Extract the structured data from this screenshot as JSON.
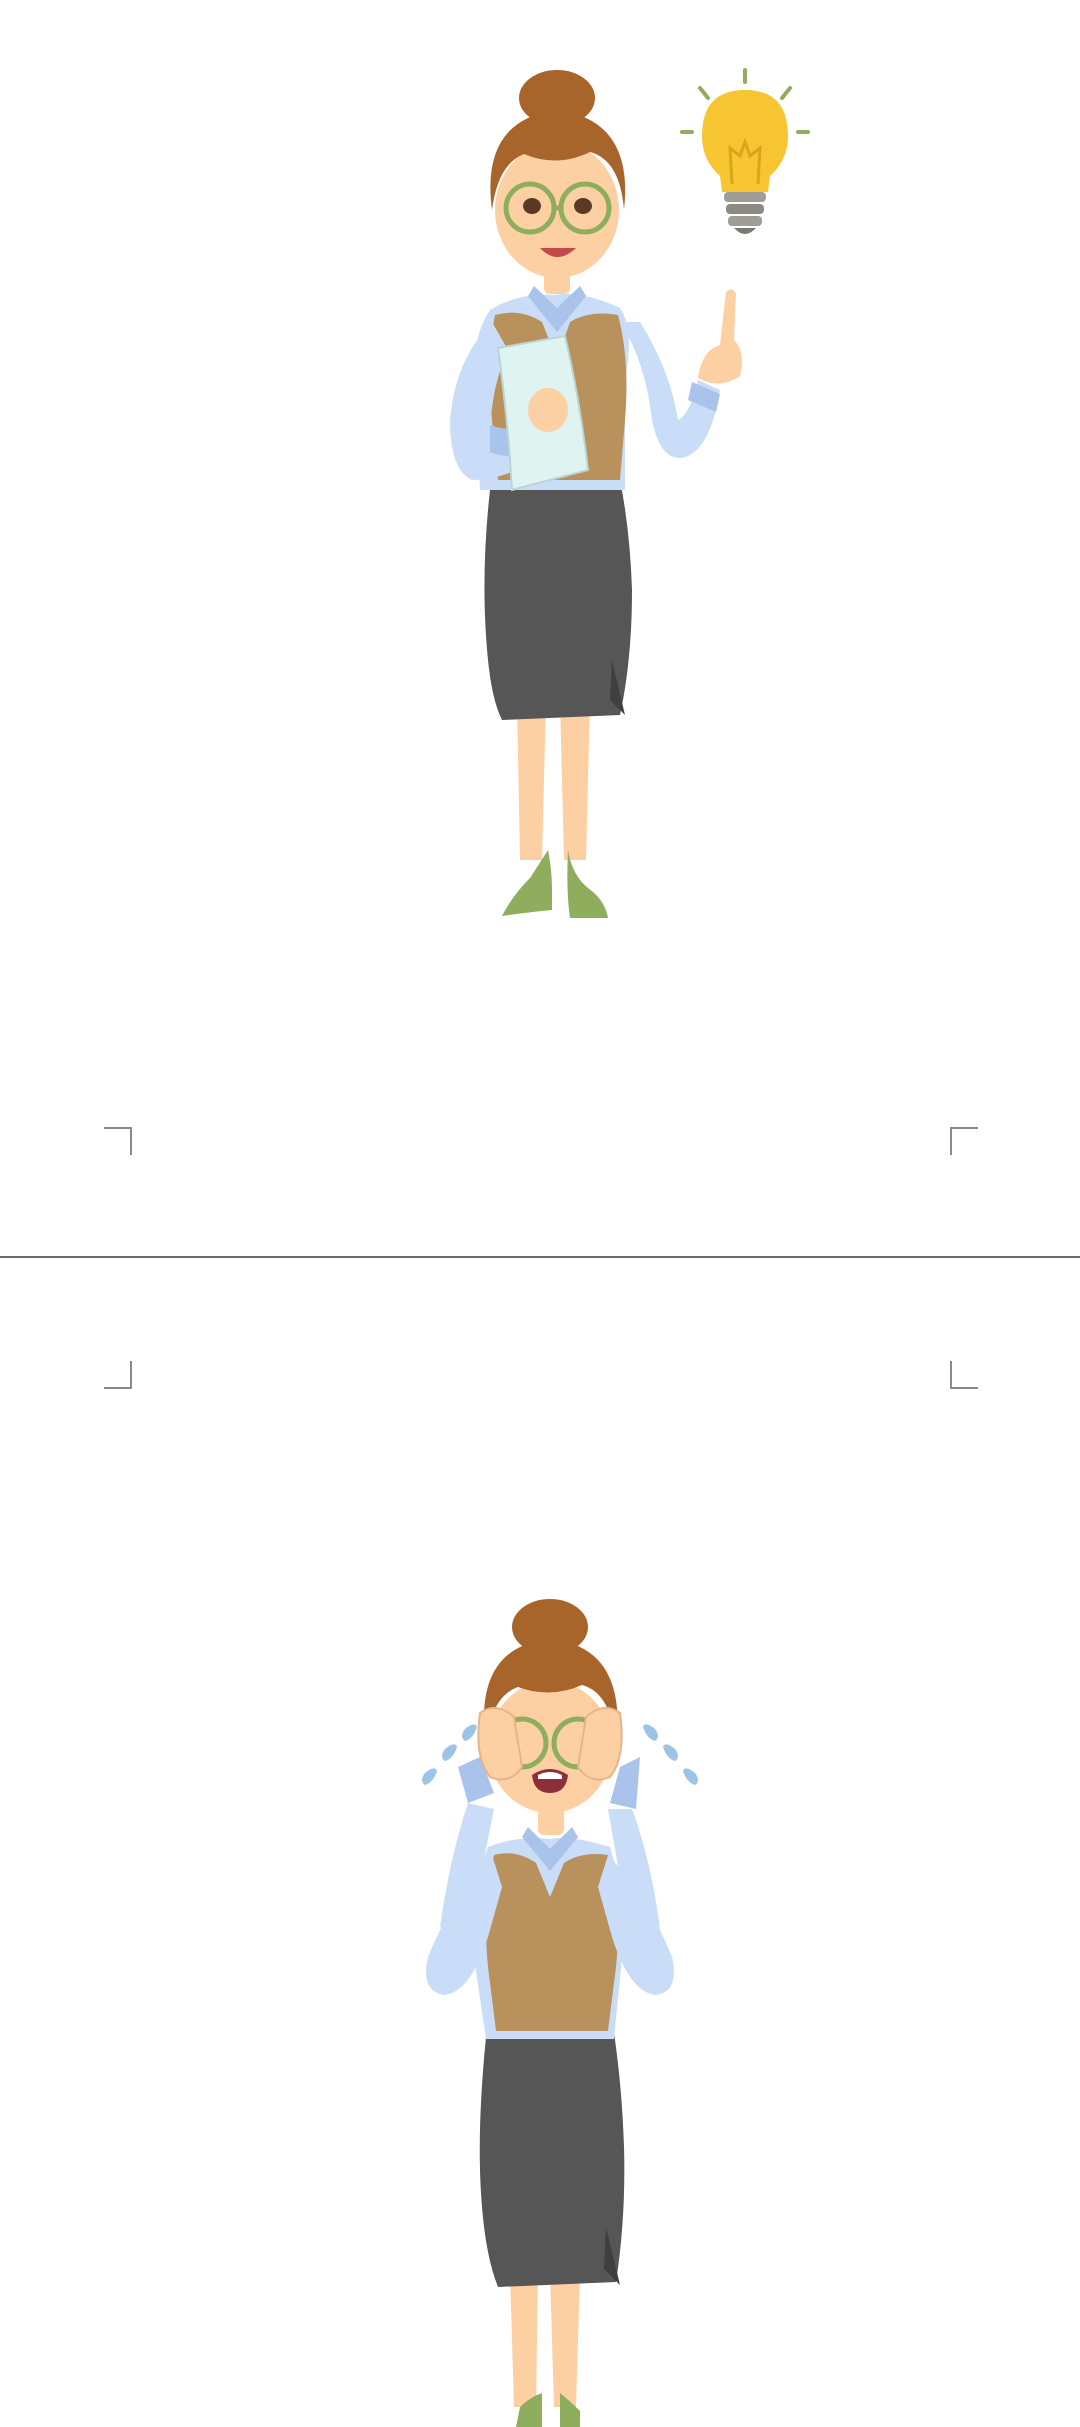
{
  "document": {
    "pages": [
      {
        "illustration": "woman-with-idea-lightbulb",
        "icons": [
          "lightbulb-icon"
        ]
      },
      {
        "illustration": "woman-crying",
        "icons": [
          "tear-drops-icon"
        ]
      }
    ]
  },
  "colors": {
    "hair": "#a8652b",
    "skin": "#fdd0a3",
    "shirt": "#c9dcf8",
    "vest": "#b9915c",
    "skirt": "#565656",
    "shoes": "#8fae5d",
    "glasses": "#8fae5d",
    "folder": "#dff3f1",
    "bulb": "#f6c531",
    "tears": "#9cc4e6",
    "page_break": "#6b6b6b"
  }
}
